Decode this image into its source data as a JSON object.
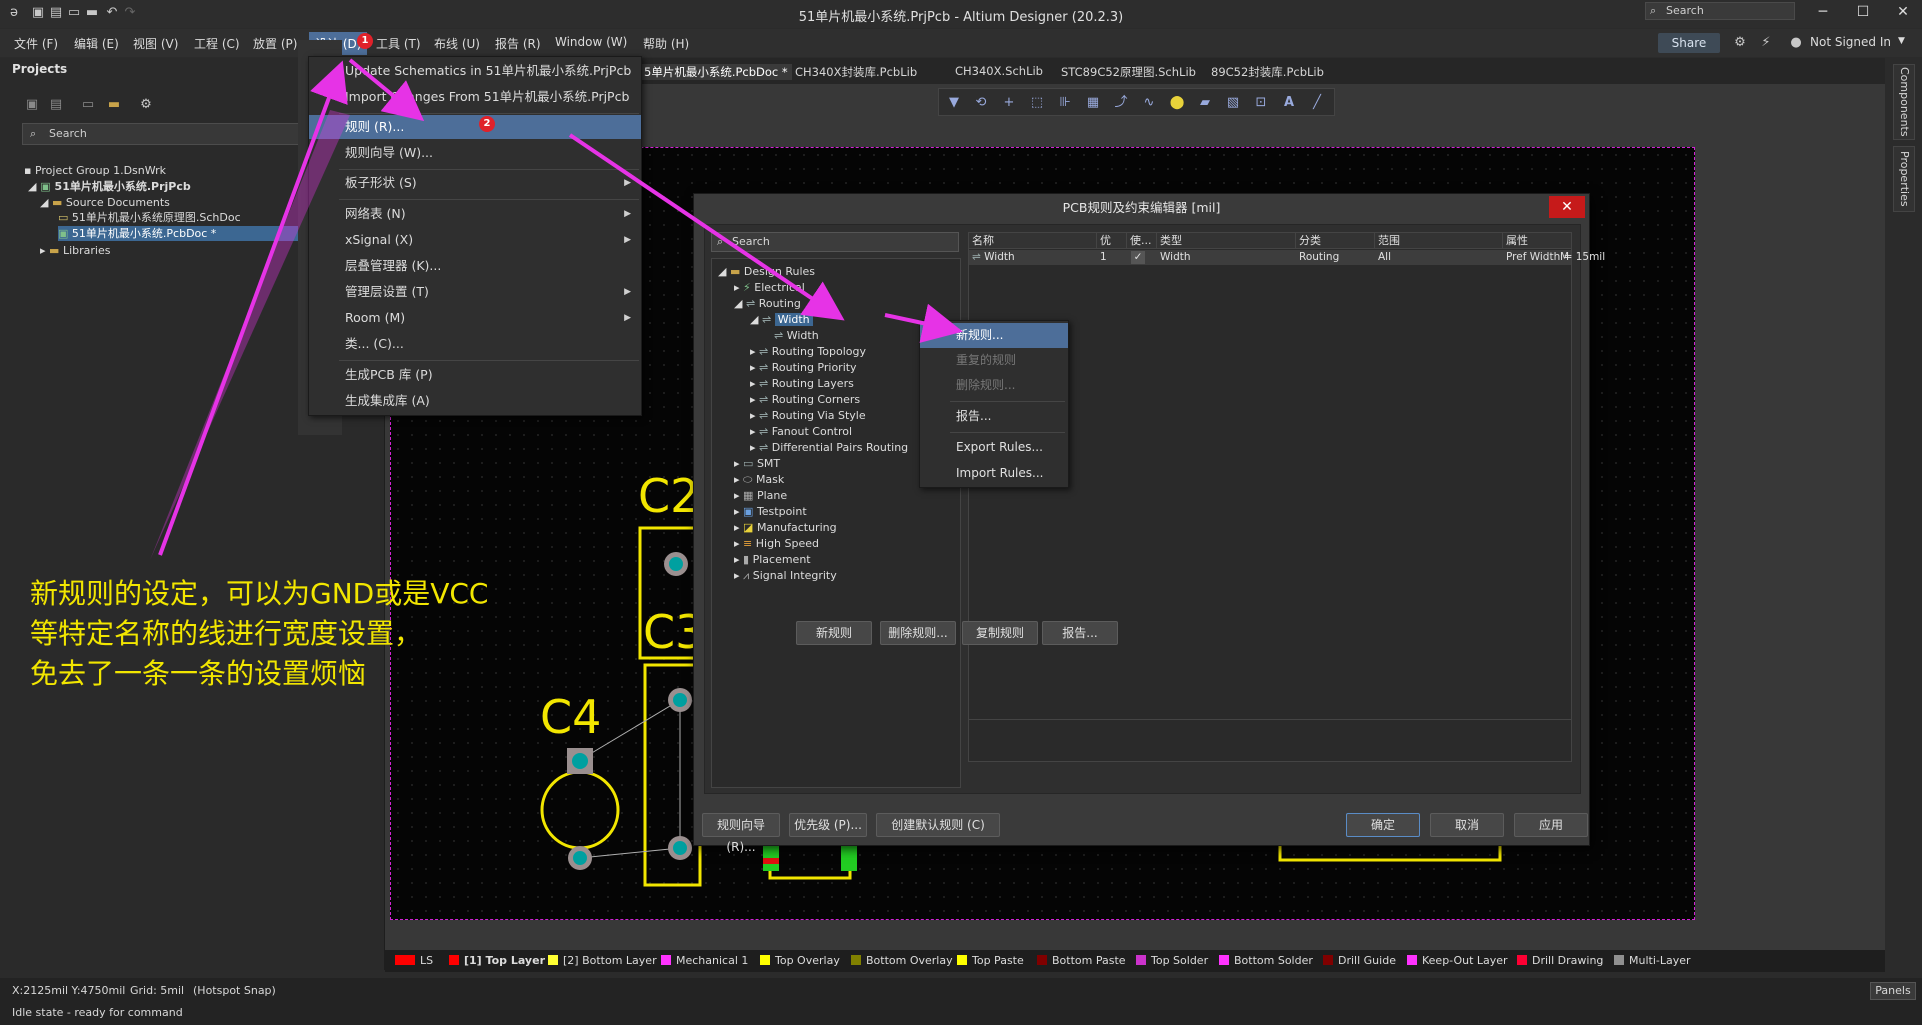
{
  "titlebar": {
    "title": "51单片机最小系统.PrjPcb - Altium Designer (20.2.3)",
    "search_placeholder": "Search"
  },
  "menubar": {
    "items": [
      "文件 (F)",
      "编辑 (E)",
      "视图 (V)",
      "工程 (C)",
      "放置 (P)",
      "设计 (D)",
      "工具 (T)",
      "布线 (U)",
      "报告 (R)",
      "Window (W)",
      "帮助 (H)"
    ],
    "share": "Share",
    "user": "Not Signed In"
  },
  "projects": {
    "header": "Projects",
    "search_placeholder": "Search",
    "tree": [
      "Project Group 1.DsnWrk",
      "51单片机最小系统.PrjPcb",
      "Source Documents",
      "51单片机最小系统原理图.SchDoc",
      "51单片机最小系统.PcbDoc *",
      "Libraries"
    ]
  },
  "doc_tabs": [
    "5单片机最小系统.PcbDoc *",
    "CH340X封装库.PcbLib",
    "CH340X.SchLib",
    "STC89C52原理图.SchLib",
    "89C52封装库.PcbLib"
  ],
  "design_menu": {
    "items": [
      "Update Schematics in 51单片机最小系统.PrjPcb",
      "Import Changes From 51单片机最小系统.PrjPcb",
      "规则 (R)...",
      "规则向导 (W)...",
      "板子形状 (S)",
      "网络表 (N)",
      "xSignal (X)",
      "层叠管理器 (K)...",
      "管理层设置 (T)",
      "Room (M)",
      "类... (C)...",
      "生成PCB 库 (P)",
      "生成集成库 (A)"
    ]
  },
  "badges": [
    "1",
    "2"
  ],
  "dialog": {
    "title": "PCB规则及约束编辑器 [mil]",
    "close": "✕",
    "search_placeholder": "Search",
    "tree": [
      "Design Rules",
      "Electrical",
      "Routing",
      "Width",
      "Width",
      "Routing Topology",
      "Routing Priority",
      "Routing Layers",
      "Routing Corners",
      "Routing Via Style",
      "Fanout Control",
      "Differential Pairs Routing",
      "SMT",
      "Mask",
      "Plane",
      "Testpoint",
      "Manufacturing",
      "High Speed",
      "Placement",
      "Signal Integrity"
    ],
    "grid_headers": [
      "名称",
      "优",
      "使...",
      "类型",
      "分类",
      "范围",
      "属性"
    ],
    "grid_row": [
      "Width",
      "1",
      "✓",
      "Width",
      "Routing",
      "All",
      "Pref Width = 15mil",
      "M"
    ],
    "inner_buttons": [
      "新规则",
      "删除规则...",
      "复制规则",
      "报告..."
    ],
    "footer_buttons": [
      "规则向导 (R)...",
      "优先级 (P)...",
      "创建默认规则 (C)",
      "确定",
      "取消",
      "应用"
    ]
  },
  "context_menu": {
    "items": [
      "新规则...",
      "重复的规则",
      "删除规则...",
      "报告...",
      "Export Rules...",
      "Import Rules..."
    ]
  },
  "pcb_labels": [
    "C2",
    "C3",
    "C4"
  ],
  "annotation": [
    "新规则的设定，可以为GND或是VCC",
    "等特定名称的线进行宽度设置，",
    "免去了一条一条的设置烦恼"
  ],
  "layers": [
    "LS",
    "[1] Top Layer",
    "[2] Bottom Layer",
    "Mechanical 1",
    "Top Overlay",
    "Bottom Overlay",
    "Top Paste",
    "Bottom Paste",
    "Top Solder",
    "Bottom Solder",
    "Drill Guide",
    "Keep-Out Layer",
    "Drill Drawing",
    "Multi-Layer"
  ],
  "layer_colors": [
    "#ff0000",
    "#ff0000",
    "#ffff33",
    "#ff33ff",
    "#ffff00",
    "#808000",
    "#ffff00",
    "#800000",
    "#cc33cc",
    "#ff33ff",
    "#800000",
    "#ff33ff",
    "#ff0033",
    "#909090"
  ],
  "right_tabs": [
    "Components",
    "Properties"
  ],
  "status": {
    "coords": "X:2125mil Y:4750mil",
    "grid": "Grid: 5mil",
    "snap": "(Hotspot Snap)",
    "state": "Idle state - ready for command",
    "panels": "Panels"
  },
  "colors": {
    "accent": "#4d6e99",
    "arrow": "#e633e6",
    "annotation": "#f2e600",
    "close": "#c61a1a"
  }
}
